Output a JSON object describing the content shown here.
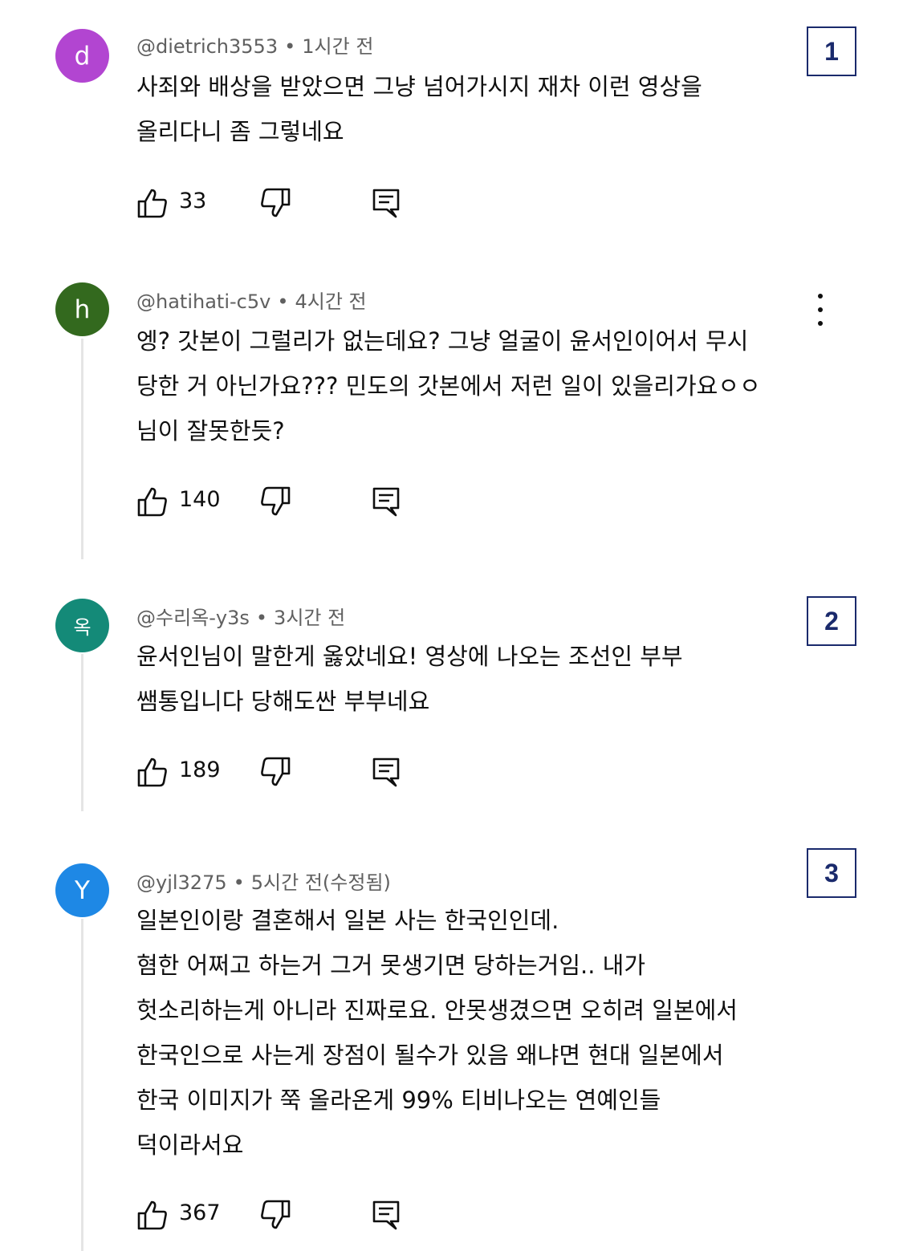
{
  "colors": {
    "avatar_d": "#b245d1",
    "avatar_h": "#33691e",
    "avatar_ok": "#148a78",
    "avatar_y": "#1e88e5",
    "marker_border": "#1a2a6c"
  },
  "comments": [
    {
      "avatar_letter": "d",
      "author": "@dietrich3553",
      "time": "1시간 전",
      "lines": [
        "사죄와 배상을 받았으면 그냥 넘어가시지 재차 이런 영상을",
        "올리다니 좀 그렇네요"
      ],
      "likes": "33",
      "marker": "1"
    },
    {
      "avatar_letter": "h",
      "author": "@hatihati-c5v",
      "time": "4시간 전",
      "lines": [
        "엥? 갓본이 그럴리가 없는데요? 그냥 얼굴이 윤서인이어서 무시",
        "당한 거 아닌가요??? 민도의 갓본에서 저런 일이 있을리가요ㅇㅇ",
        "님이 잘못한듯?"
      ],
      "likes": "140"
    },
    {
      "avatar_letter": "옥",
      "author": "@수리옥-y3s",
      "time": "3시간 전",
      "lines": [
        "윤서인님이 말한게 옳았네요! 영상에 나오는 조선인 부부",
        "쌤통입니다 당해도싼 부부네요"
      ],
      "likes": "189",
      "marker": "2"
    },
    {
      "avatar_letter": "Y",
      "author": "@yjl3275",
      "time": "5시간 전(수정됨)",
      "lines": [
        "일본인이랑 결혼해서 일본 사는 한국인인데.",
        "혐한 어쩌고 하는거 그거 못생기면 당하는거임.. 내가",
        "헛소리하는게 아니라 진짜로요. 안못생겼으면 오히려 일본에서",
        "한국인으로 사는게 장점이 될수가 있음 왜냐면 현대 일본에서",
        "한국 이미지가 쭉 올라온게 99% 티비나오는 연예인들",
        "덕이라서요"
      ],
      "likes": "367",
      "marker": "3"
    }
  ]
}
